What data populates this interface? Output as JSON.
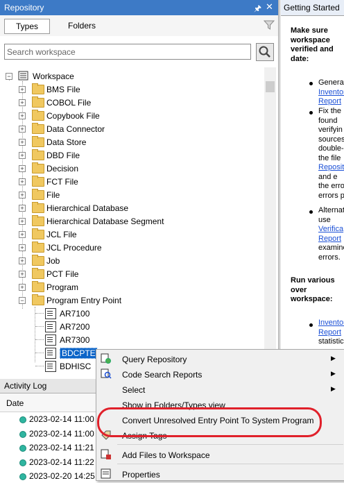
{
  "repository": {
    "title": "Repository",
    "pin_icon": "pin-icon",
    "close_icon": "close-icon",
    "tabs": [
      "Types",
      "Folders"
    ],
    "search_placeholder": "Search workspace",
    "root": "Workspace",
    "types": [
      "BMS File",
      "COBOL File",
      "Copybook File",
      "Data Connector",
      "Data Store",
      "DBD File",
      "Decision",
      "FCT File",
      "File",
      "Hierarchical Database",
      "Hierarchical Database Segment",
      "JCL File",
      "JCL Procedure",
      "Job",
      "PCT File",
      "Program",
      "Program Entry Point"
    ],
    "entry_points": [
      "AR7100",
      "AR7200",
      "AR7300",
      "BDCPTE",
      "BDHISC"
    ]
  },
  "getting_started": {
    "tab": "Getting Started",
    "heading1": [
      "Make    sure",
      "workspace",
      "verified   and",
      "date:"
    ],
    "bullet1": [
      "Generat",
      "Inventor",
      "Report",
      "."
    ],
    "bullet2": [
      "Fix   the",
      "found",
      "verifyin",
      "sources",
      "double-",
      "the  file",
      "Reposit",
      "and    e",
      "the erro",
      "errors p"
    ],
    "bullet3": [
      "Alternat",
      "use",
      "Verifica",
      "Report",
      "examine",
      "errors."
    ],
    "heading2": [
      "Run   various",
      "over",
      "workspace:"
    ],
    "bullet4": [
      "Inventor",
      "Report",
      "statistic"
    ]
  },
  "activity_log": {
    "title": "Activity Log",
    "column": "Date",
    "entries": [
      "2023-02-14 11:00",
      "2023-02-14 11:00",
      "2023-02-14 11:21",
      "2023-02-14 11:22",
      "2023-02-20 14:25"
    ]
  },
  "context_menu": {
    "items": [
      "Query Repository",
      "Code Search Reports",
      "Select",
      "Show in Folders/Types view",
      "Convert Unresolved Entry Point To System Program",
      "Assign Tags",
      "Add Files to Workspace",
      "Properties"
    ]
  },
  "colors": {
    "titlebar": "#3d7ac6",
    "highlight_oval": "#e0202a",
    "selection": "#0a64c8"
  }
}
